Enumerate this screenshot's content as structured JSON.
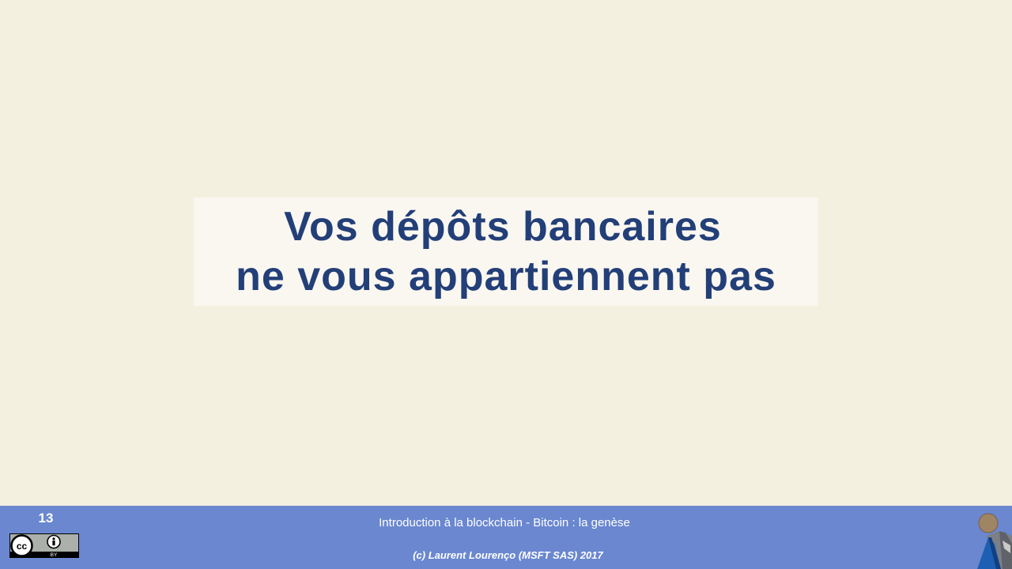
{
  "slide": {
    "title_line1": "Vos dépôts bancaires",
    "title_line2": "ne vous appartiennent pas"
  },
  "footer": {
    "page_number": "13",
    "title": "Introduction  à la blockchain - Bitcoin : la genèse",
    "copyright": "(c) Laurent Lourenço (MSFT SAS) 2017",
    "license_badge": {
      "icon": "creative-commons-by-icon",
      "text": "BY"
    },
    "logo_icon": "person-figure-logo-icon"
  },
  "colors": {
    "background": "#f3f0e0",
    "title_box": "#faf7f1",
    "title_text": "#233f78",
    "footer_bar": "#6a87d0",
    "footer_text": "#ffffff"
  }
}
